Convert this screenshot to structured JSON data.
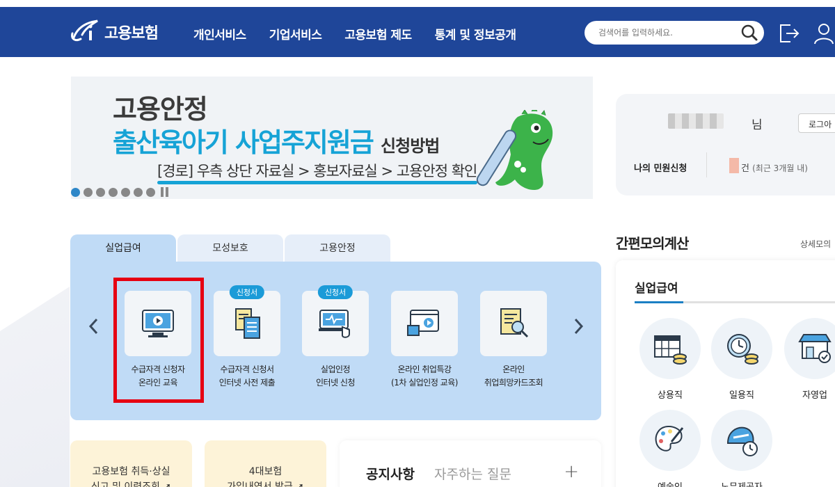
{
  "header": {
    "logo_text": "고용보험",
    "nav": [
      "개인서비스",
      "기업서비스",
      "고용보험 제도",
      "통계 및 정보공개"
    ],
    "search_placeholder": "검색어를 입력하세요."
  },
  "banner": {
    "line1": "고용안정",
    "line2_main": "출산육아기 사업주지원금",
    "line2_sub": "신청방법",
    "line3": "[경로] 우측 상단 자료실 > 홍보자료실 > 고용안정 확인",
    "dot_count": 7,
    "active_dot": 0
  },
  "login": {
    "suffix": "님",
    "button": "로그아",
    "my_label": "나의 민원신청",
    "count_unit": "건",
    "count_period": "(최근 3개월 내)"
  },
  "tabs": [
    "실업급여",
    "모성보호",
    "고용안정"
  ],
  "active_tab": 0,
  "services": [
    {
      "line1": "수급자격 신청자",
      "line2": "온라인 교육",
      "badge": ""
    },
    {
      "line1": "수급자격 신청서",
      "line2": "인터넷 사전 제출",
      "badge": "신청서"
    },
    {
      "line1": "실업인정",
      "line2": "인터넷 신청",
      "badge": "신청서"
    },
    {
      "line1": "온라인 취업특강",
      "line2": "(1차 실업인정 교육)",
      "badge": ""
    },
    {
      "line1": "온라인",
      "line2": "취업희망카드조회",
      "badge": ""
    }
  ],
  "bottom_cards": [
    {
      "line1": "고용보험 취득·상실",
      "line2": "신고 및 이력조회 ➚"
    },
    {
      "line1": "4대보험",
      "line2": "가입내역서 발급 ➚"
    }
  ],
  "notice": {
    "title": "공지사항",
    "title2": "자주하는 질문",
    "plus": "+"
  },
  "calc": {
    "title": "간편모의계산",
    "more": "상세모의",
    "subtitle": "실업급여",
    "items": [
      "상용직",
      "일용직",
      "자영업",
      "예술인",
      "노무제공자"
    ]
  },
  "colors": {
    "header_bg": "#1f4699",
    "accent": "#16a3d6",
    "panel": "#c0dbf6",
    "highlight": "#e60012"
  }
}
